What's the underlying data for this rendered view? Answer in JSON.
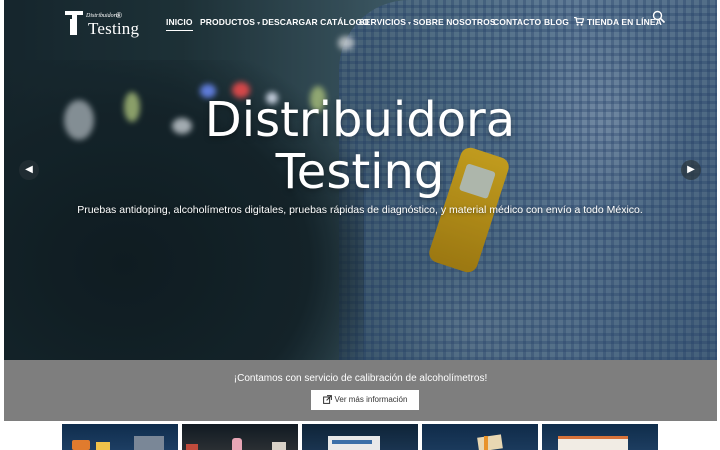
{
  "brand": {
    "small": "Distribuidora",
    "name": "Testing",
    "registered": "®"
  },
  "nav": {
    "items": [
      {
        "label": "INICIO",
        "active": true
      },
      {
        "label": "PRODUCTOS",
        "dropdown": true
      },
      {
        "label": "DESCARGAR CATÁLOGO"
      },
      {
        "label": "SERVICIOS",
        "dropdown": true
      },
      {
        "label": "SOBRE NOSOTROS"
      },
      {
        "label": "CONTACTO"
      },
      {
        "label": "BLOG"
      },
      {
        "label": "TIENDA EN LÍNEA",
        "icon": "cart-icon"
      }
    ],
    "search_icon": "search-icon"
  },
  "hero": {
    "title_line1": "Distribuidora",
    "title_line2": "Testing",
    "subtitle": "Pruebas antidoping, alcoholímetros digitales, pruebas rápidas de diagnóstico, y material médico con envío a todo México.",
    "prev_icon": "chevron-left-icon",
    "next_icon": "chevron-right-icon"
  },
  "banner": {
    "text": "¡Contamos con servicio de calibración de alcoholímetros!",
    "button_label": "Ver más información",
    "button_icon": "external-link-icon",
    "background": "#7e7e7e"
  },
  "products_strip": {
    "thumbnail_count": 5
  }
}
